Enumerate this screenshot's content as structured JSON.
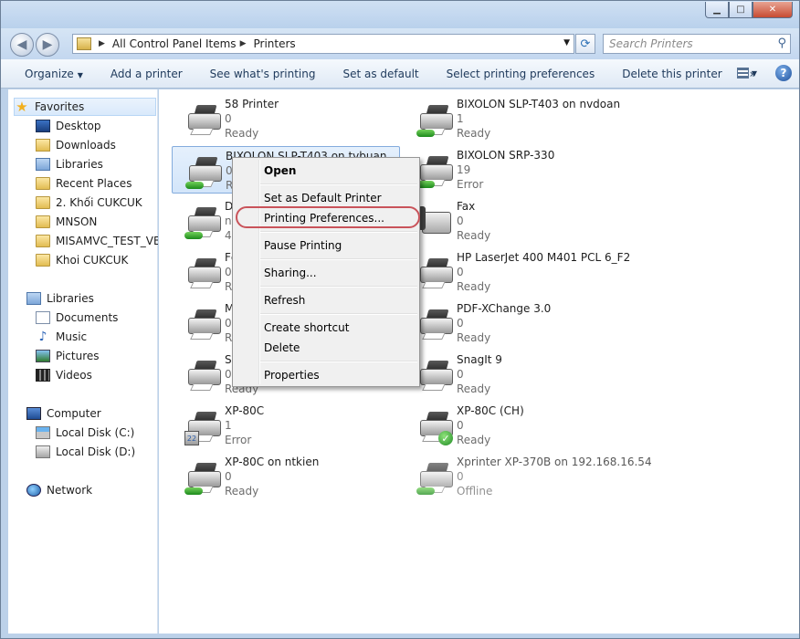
{
  "window": {
    "controls": {
      "minimize": "▁",
      "maximize": "□",
      "close": "✕"
    }
  },
  "address": {
    "crumbs": [
      "All Control Panel Items",
      "Printers"
    ],
    "search_placeholder": "Search Printers"
  },
  "toolbar": {
    "organize": "Organize",
    "add_printer": "Add a printer",
    "whats_printing": "See what's printing",
    "set_default": "Set as default",
    "prefs": "Select printing preferences",
    "delete": "Delete this printer",
    "more": "»",
    "help": "?"
  },
  "nav": {
    "favorites": "Favorites",
    "desktop": "Desktop",
    "downloads": "Downloads",
    "libraries_fav": "Libraries",
    "recent": "Recent Places",
    "khoi2": "2. Khối CUKCUK",
    "mnson": "MNSON",
    "misamvc": "MISAMVC_TEST_VERSION",
    "khoi": "Khoi CUKCUK",
    "libraries": "Libraries",
    "documents": "Documents",
    "music": "Music",
    "pictures": "Pictures",
    "videos": "Videos",
    "computer": "Computer",
    "diskc": "Local Disk (C:)",
    "diskd": "Local Disk (D:)",
    "network": "Network"
  },
  "printers_left": [
    {
      "name": "58 Printer",
      "count": "0",
      "status": "Ready"
    },
    {
      "name": "BIXOLON SLP-T403 on tvbuan",
      "count": "0",
      "status": "Ready"
    },
    {
      "name": "D",
      "count": "n",
      "status": "4"
    },
    {
      "name": "Fc",
      "count": "0",
      "status": "R"
    },
    {
      "name": "M",
      "count": "0",
      "status": "R"
    },
    {
      "name": "Sr",
      "count": "0",
      "status": "Ready"
    },
    {
      "name": "XP-80C",
      "count": "1",
      "status": "Error"
    },
    {
      "name": "XP-80C on ntkien",
      "count": "0",
      "status": "Ready"
    }
  ],
  "printers_right": [
    {
      "name": "BIXOLON SLP-T403 on nvdoan",
      "count": "1",
      "status": "Ready"
    },
    {
      "name": "BIXOLON SRP-330",
      "count": "19",
      "status": "Error"
    },
    {
      "name": "Fax",
      "count": "0",
      "status": "Ready"
    },
    {
      "name": "HP LaserJet 400 M401 PCL 6_F2",
      "count": "0",
      "status": "Ready"
    },
    {
      "name": "PDF-XChange 3.0",
      "count": "0",
      "status": "Ready"
    },
    {
      "name": "SnagIt 9",
      "count": "0",
      "status": "Ready"
    },
    {
      "name": "XP-80C (CH)",
      "count": "0",
      "status": "Ready"
    },
    {
      "name": "Xprinter XP-370B on 192.168.16.54",
      "count": "0",
      "status": "Offline"
    }
  ],
  "context_menu": {
    "open": "Open",
    "set_default": "Set as Default Printer",
    "prefs": "Printing Preferences...",
    "pause": "Pause Printing",
    "sharing": "Sharing...",
    "refresh": "Refresh",
    "shortcut": "Create shortcut",
    "delete": "Delete",
    "properties": "Properties"
  },
  "colors": {
    "highlight_oval": "#c9535a",
    "selection": "#d3e5fa"
  }
}
